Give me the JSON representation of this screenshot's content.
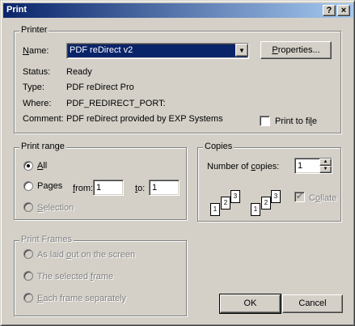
{
  "window": {
    "title": "Print",
    "help_label": "?",
    "close_label": "×"
  },
  "printer": {
    "group_label": "Printer",
    "name_label": "Name:",
    "name_value": "PDF reDirect v2",
    "properties_label": "Properties...",
    "status_label": "Status:",
    "status_value": "Ready",
    "type_label": "Type:",
    "type_value": "PDF reDirect Pro",
    "where_label": "Where:",
    "where_value": "PDF_REDIRECT_PORT:",
    "comment_label": "Comment:",
    "comment_value": "PDF reDirect provided by EXP Systems",
    "print_to_file_label": "Print to file"
  },
  "print_range": {
    "group_label": "Print range",
    "all_label": "All",
    "pages_label": "Pages",
    "from_label": "from:",
    "from_value": "1",
    "to_label": "to:",
    "to_value": "1",
    "selection_label": "Selection"
  },
  "copies": {
    "group_label": "Copies",
    "number_label": "Number of copies:",
    "number_value": "1",
    "collate_label": "Collate",
    "page_numbers": [
      "1",
      "2",
      "3"
    ]
  },
  "print_frames": {
    "group_label": "Print Frames",
    "option1": "As laid out on the screen",
    "option2": "The selected frame",
    "option3": "Each frame separately"
  },
  "buttons": {
    "ok": "OK",
    "cancel": "Cancel"
  }
}
